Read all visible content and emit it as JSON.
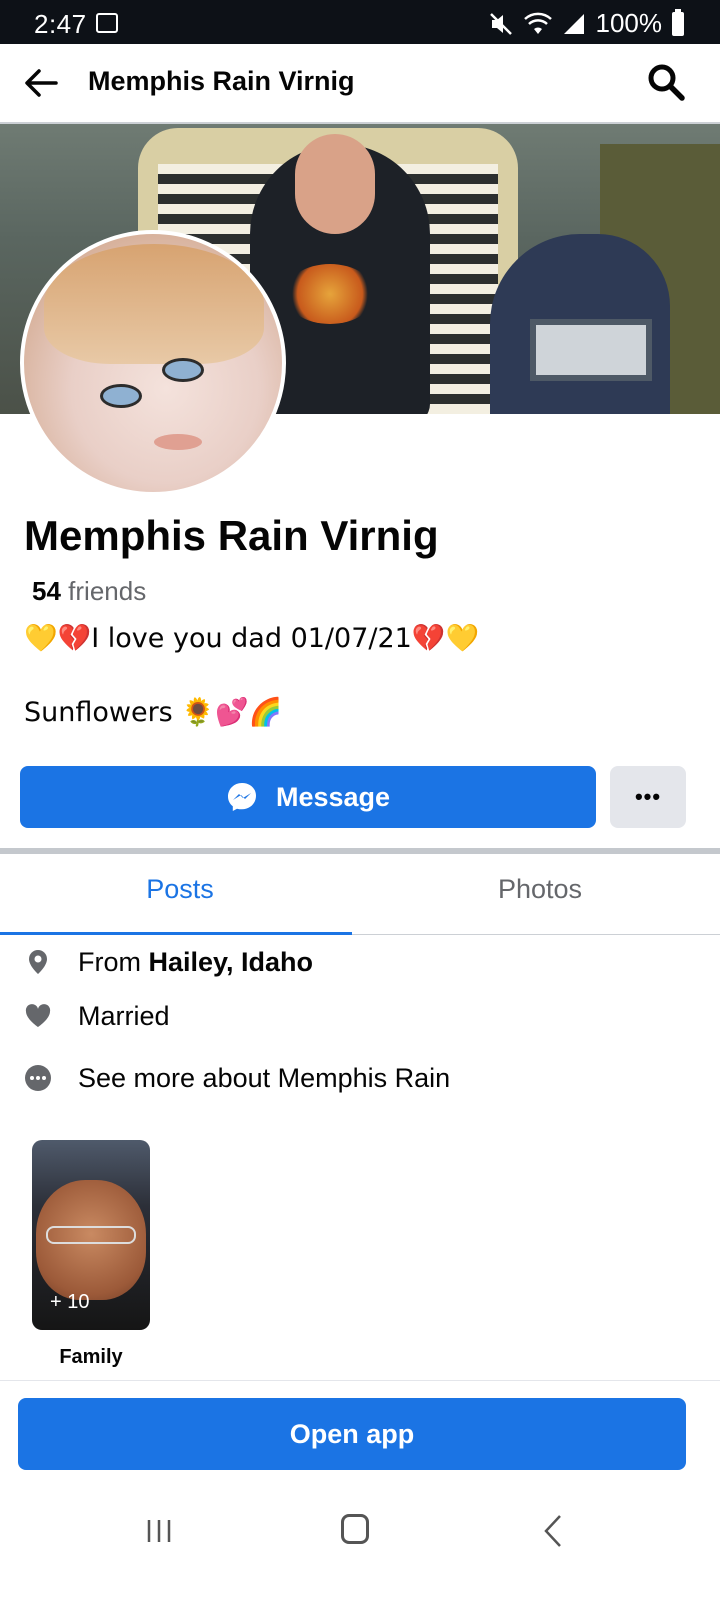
{
  "status_bar": {
    "time": "2:47",
    "battery": "100%"
  },
  "header": {
    "title": "Memphis Rain Virnig"
  },
  "profile": {
    "name": "Memphis Rain Virnig",
    "friends_count": "54",
    "friends_label": "friends",
    "bio_line1": "💛💔I love you dad 01/07/21💔💛",
    "bio_line2": "Sunflowers 🌻💕🌈"
  },
  "actions": {
    "message_label": "Message",
    "more_label": "•••"
  },
  "tabs": [
    {
      "label": "Posts",
      "active": true
    },
    {
      "label": "Photos",
      "active": false
    }
  ],
  "intro": {
    "from_prefix": "From ",
    "from_place": "Hailey, Idaho",
    "relationship": "Married",
    "see_more": "See more about Memphis Rain"
  },
  "featured": {
    "count_label": "+ 10",
    "label": "Family"
  },
  "footer": {
    "open_app_label": "Open app"
  },
  "colors": {
    "accent": "#1b74e4",
    "secondary_text": "#65676b"
  }
}
